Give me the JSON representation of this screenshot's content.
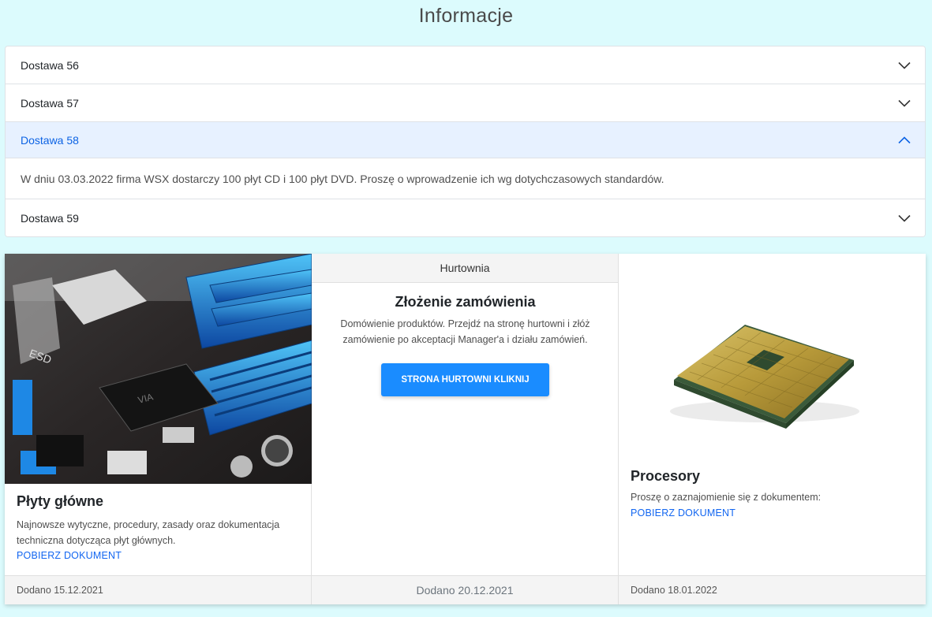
{
  "page": {
    "title": "Informacje"
  },
  "accordion": {
    "items": [
      {
        "label": "Dostawa 56",
        "expanded": false
      },
      {
        "label": "Dostawa 57",
        "expanded": false
      },
      {
        "label": "Dostawa 58",
        "expanded": true,
        "body": "W dniu 03.03.2022 firma WSX dostarczy 100 płyt CD i 100 płyt DVD. Proszę o wprowadzenie ich wg dotychczasowych standardów."
      },
      {
        "label": "Dostawa 59",
        "expanded": false
      }
    ],
    "icons": {
      "collapsed": "chevron-down-icon",
      "expanded": "chevron-up-icon"
    }
  },
  "cards": [
    {
      "image": "motherboard-image",
      "title": "Płyty główne",
      "text": "Najnowsze wytyczne, procedury, zasady oraz dokumentacja techniczna dotycząca płyt głównych.",
      "link": "POBIERZ DOKUMENT",
      "footer": "Dodano 15.12.2021"
    },
    {
      "header": "Hurtownia",
      "title": "Złożenie zamówienia",
      "text_line1": "Domówienie produktów. Przejdź na stronę hurtowni i złóż",
      "text_line2": "zamówienie po akceptacji Manager'a i działu zamówień.",
      "button": "STRONA HURTOWNI KLIKNIJ",
      "footer": "Dodano 20.12.2021"
    },
    {
      "image": "cpu-image",
      "title": "Procesory",
      "text": "Proszę o zaznajomienie się z dokumentem:",
      "link": "POBIERZ DOKUMENT",
      "footer": "Dodano 18.01.2022"
    }
  ],
  "colors": {
    "background": "#dcfbfd",
    "accent": "#1266f1",
    "button": "#1a8cff",
    "active_header_bg": "#e7f1ff"
  }
}
